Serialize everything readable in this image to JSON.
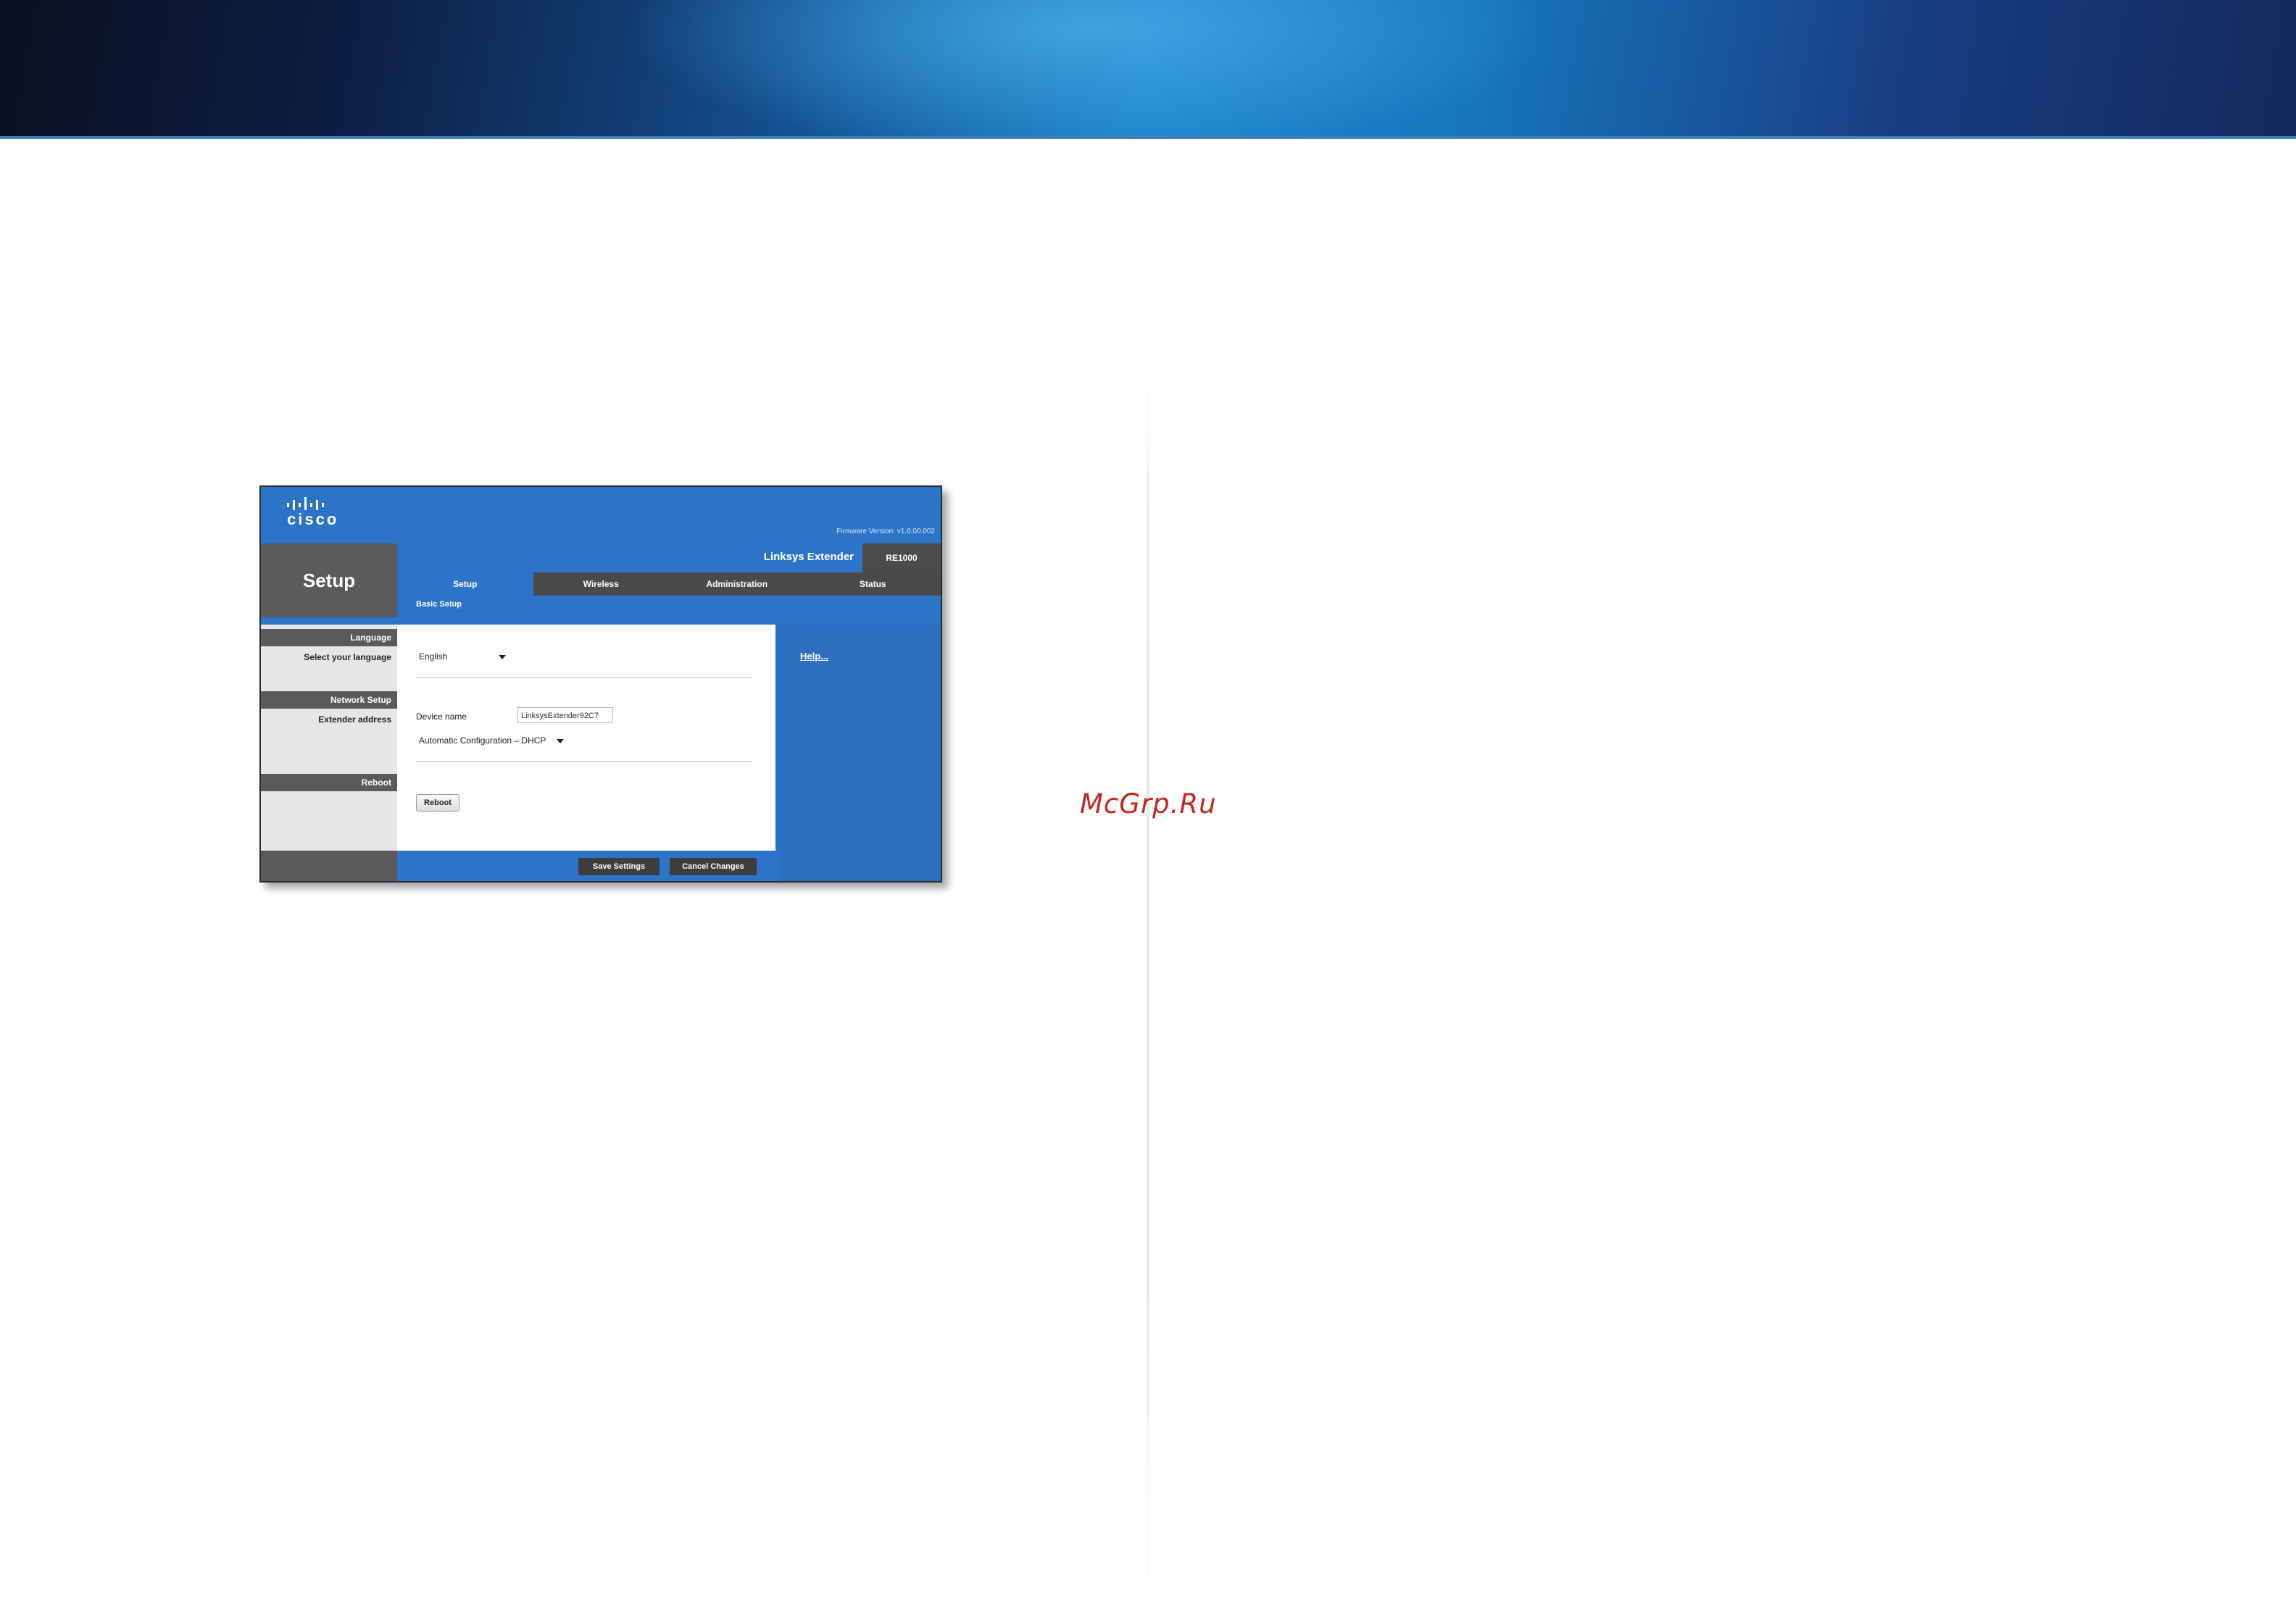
{
  "router_ui": {
    "brand": "cisco",
    "firmware_version": "Firmware Version: v1.0.00.002",
    "section_title": "Setup",
    "product_name": "Linksys Extender",
    "model": "RE1000",
    "tabs": [
      {
        "label": "Setup",
        "active": true
      },
      {
        "label": "Wireless",
        "active": false
      },
      {
        "label": "Administration",
        "active": false
      },
      {
        "label": "Status",
        "active": false
      }
    ],
    "subtab": "Basic Setup",
    "left_panel": {
      "language_heading": "Language",
      "language_label": "Select your language",
      "network_heading": "Network Setup",
      "extender_label": "Extender address",
      "reboot_heading": "Reboot"
    },
    "form": {
      "language_value": "English",
      "device_name_label": "Device name",
      "device_name_value": "LinksysExtender92C7",
      "address_mode_value": "Automatic Configuration – DHCP",
      "reboot_button": "Reboot"
    },
    "help_link": "Help...",
    "footer": {
      "save_button": "Save Settings",
      "cancel_button": "Cancel Changes"
    }
  },
  "watermark": "McGrp.Ru",
  "colors": {
    "accent_blue": "#2c74c8",
    "dark_gray": "#4a4a4a",
    "watermark_red": "#c3271d"
  }
}
